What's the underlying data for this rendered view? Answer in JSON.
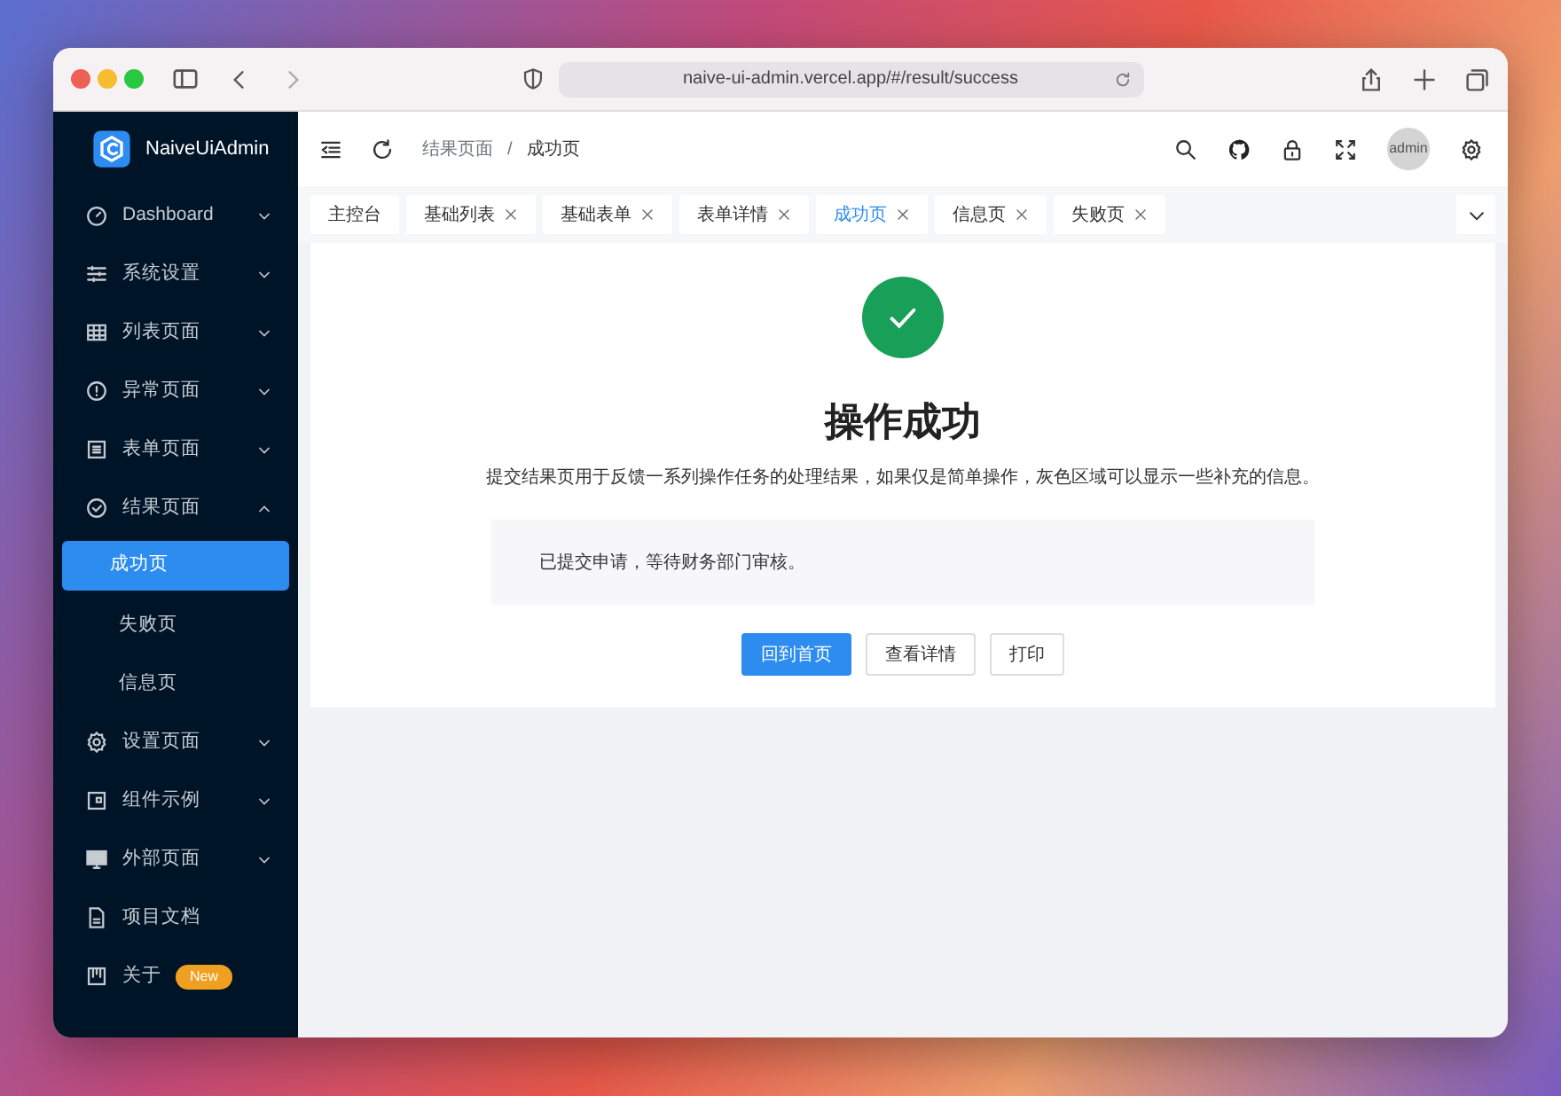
{
  "browser": {
    "url": "naive-ui-admin.vercel.app/#/result/success"
  },
  "app": {
    "logo_text": "NaiveUiAdmin"
  },
  "sidebar": {
    "items": [
      {
        "label": "Dashboard",
        "expanded": false,
        "selected": false
      },
      {
        "label": "系统设置",
        "expanded": false,
        "selected": false
      },
      {
        "label": "列表页面",
        "expanded": false,
        "selected": false
      },
      {
        "label": "异常页面",
        "expanded": false,
        "selected": false
      },
      {
        "label": "表单页面",
        "expanded": false,
        "selected": false
      },
      {
        "label": "结果页面",
        "expanded": true,
        "selected": false,
        "children": [
          {
            "label": "成功页",
            "selected": true
          },
          {
            "label": "失败页",
            "selected": false
          },
          {
            "label": "信息页",
            "selected": false
          }
        ]
      },
      {
        "label": "设置页面",
        "expanded": false,
        "selected": false
      },
      {
        "label": "组件示例",
        "expanded": false,
        "selected": false
      },
      {
        "label": "外部页面",
        "expanded": false,
        "selected": false
      },
      {
        "label": "项目文档",
        "selected": false
      },
      {
        "label": "关于",
        "selected": false,
        "badge": "New"
      }
    ]
  },
  "header": {
    "breadcrumb": [
      "结果页面",
      "成功页"
    ],
    "breadcrumb_separator": "/",
    "avatar_text": "admin"
  },
  "tabs": [
    {
      "label": "主控台",
      "closable": false,
      "selected": false
    },
    {
      "label": "基础列表",
      "closable": true,
      "selected": false
    },
    {
      "label": "基础表单",
      "closable": true,
      "selected": false
    },
    {
      "label": "表单详情",
      "closable": true,
      "selected": false
    },
    {
      "label": "成功页",
      "closable": true,
      "selected": true
    },
    {
      "label": "信息页",
      "closable": true,
      "selected": false
    },
    {
      "label": "失败页",
      "closable": true,
      "selected": false
    }
  ],
  "result": {
    "title": "操作成功",
    "description": "提交结果页用于反馈一系列操作任务的处理结果，如果仅是简单操作，灰色区域可以显示一些补充的信息。",
    "note": "已提交申请，等待财务部门审核。",
    "buttons": [
      {
        "label": "回到首页",
        "kind": "primary"
      },
      {
        "label": "查看详情",
        "kind": "default"
      },
      {
        "label": "打印",
        "kind": "default"
      }
    ]
  }
}
